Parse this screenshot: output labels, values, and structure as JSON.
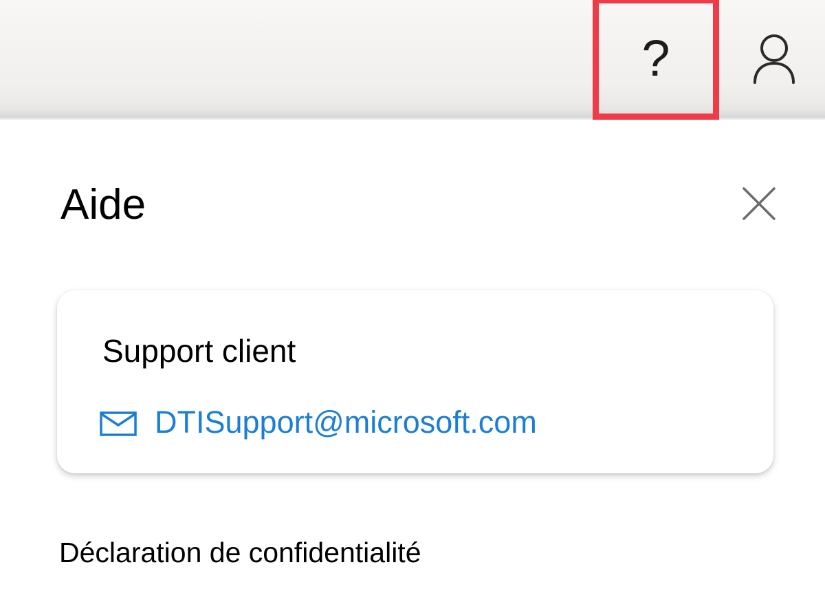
{
  "topbar": {
    "help_button": {
      "label": "?",
      "icon": "question-mark-icon",
      "highlight_color": "#ef3a48"
    },
    "account_button": {
      "icon": "person-icon"
    }
  },
  "panel": {
    "title": "Aide",
    "close_icon": "close-icon",
    "support_card": {
      "title": "Support client",
      "email_icon": "mail-icon",
      "email": "DTISupport@microsoft.com",
      "link_color": "#1a7fd4"
    },
    "privacy_link": "Déclaration de confidentialité"
  }
}
